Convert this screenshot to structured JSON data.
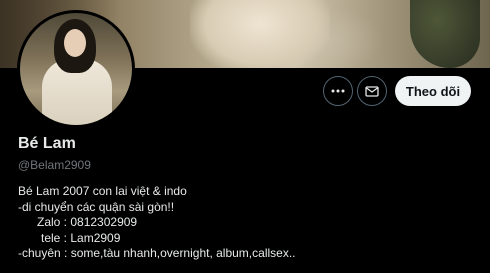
{
  "profile": {
    "display_name": "Bé Lam",
    "handle": "@Belam2909",
    "bio_lines": [
      "Bé Lam 2007 con lai việt & indo",
      "-di chuyển các quận sài gòn!!",
      "Zalo : 0812302909",
      "tele : Lam2909",
      "-chuyên : some,tàu nhanh,overnight, album,callsex.."
    ]
  },
  "actions": {
    "more_icon": "more-horizontal-icon",
    "message_icon": "envelope-icon",
    "follow_label": "Theo dõi"
  },
  "colors": {
    "background": "#000000",
    "text_primary": "#e7e9ea",
    "text_secondary": "#71767b",
    "button_border": "#536471",
    "follow_bg": "#eff3f4",
    "follow_text": "#0f1419"
  }
}
